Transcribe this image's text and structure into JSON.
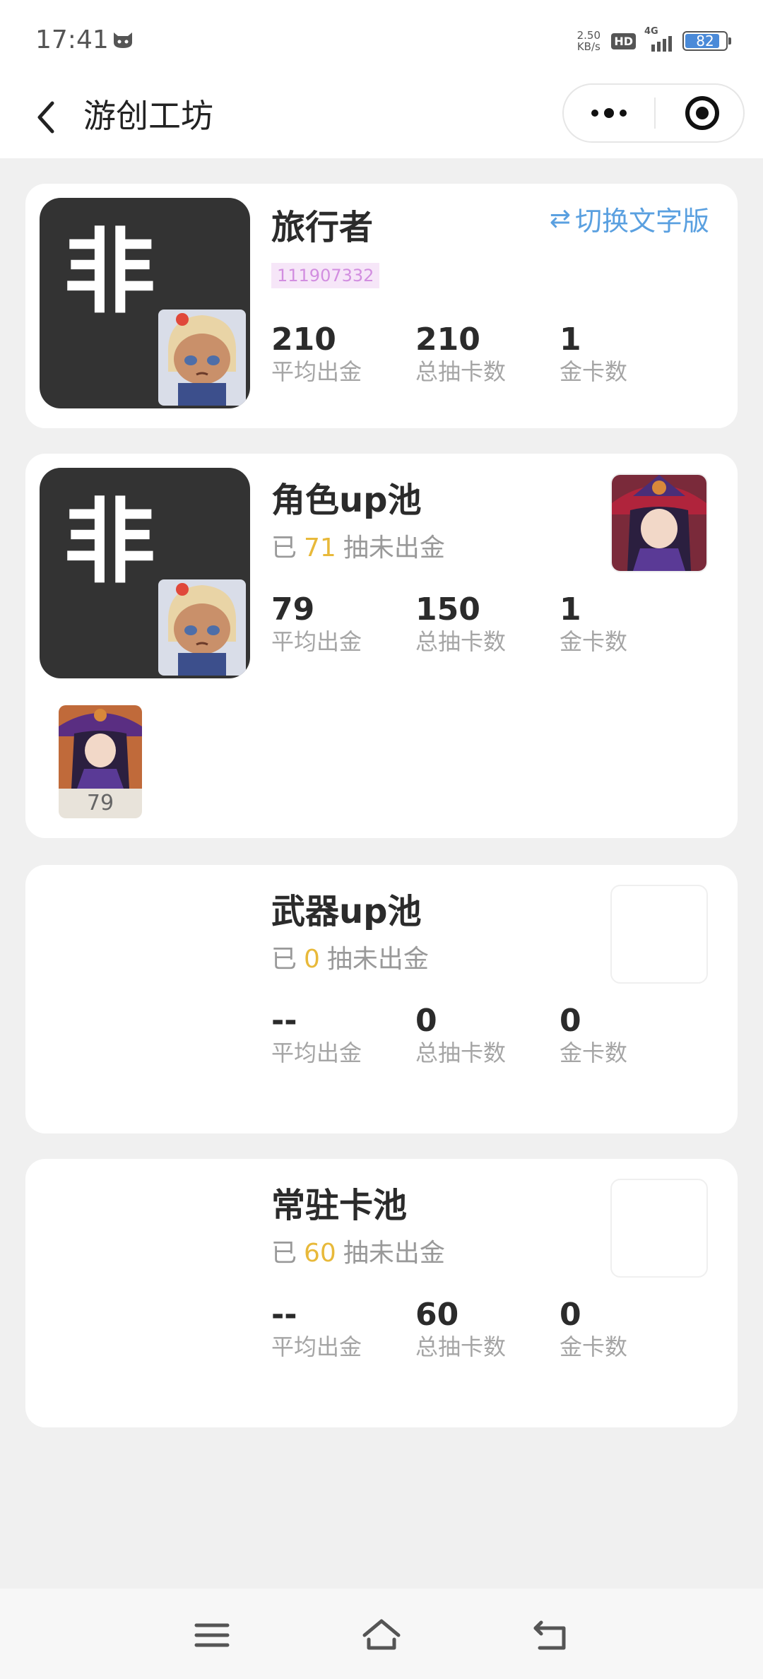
{
  "status_bar": {
    "time": "17:41",
    "net_speed_value": "2.50",
    "net_speed_unit": "KB/s",
    "hd": "HD",
    "network": "4G",
    "battery": "82"
  },
  "nav": {
    "title": "游创工坊"
  },
  "profile_card": {
    "avatar_char": "非",
    "name": "旅行者",
    "uid": "111907332",
    "switch_label": "切换文字版",
    "stats": [
      {
        "value": "210",
        "label": "平均出金"
      },
      {
        "value": "210",
        "label": "总抽卡数"
      },
      {
        "value": "1",
        "label": "金卡数"
      }
    ]
  },
  "pools": [
    {
      "title": "角色up池",
      "sub_prefix": "已",
      "sub_count": "71",
      "sub_suffix": "抽未出金",
      "avatar_char": "非",
      "stats": [
        {
          "value": "79",
          "label": "平均出金"
        },
        {
          "value": "150",
          "label": "总抽卡数"
        },
        {
          "value": "1",
          "label": "金卡数"
        }
      ],
      "history_count": "79"
    },
    {
      "title": "武器up池",
      "sub_prefix": "已",
      "sub_count": "0",
      "sub_suffix": "抽未出金",
      "stats": [
        {
          "value": "--",
          "label": "平均出金"
        },
        {
          "value": "0",
          "label": "总抽卡数"
        },
        {
          "value": "0",
          "label": "金卡数"
        }
      ]
    },
    {
      "title": "常驻卡池",
      "sub_prefix": "已",
      "sub_count": "60",
      "sub_suffix": "抽未出金",
      "stats": [
        {
          "value": "--",
          "label": "平均出金"
        },
        {
          "value": "60",
          "label": "总抽卡数"
        },
        {
          "value": "0",
          "label": "金卡数"
        }
      ]
    }
  ],
  "colors": {
    "accent_blue": "#5aa0e0",
    "highlight_yellow": "#e8b93a",
    "uid_pink": "#d28ee0"
  },
  "icons": {
    "back": "chevron-left-icon",
    "more": "more-dots-icon",
    "close": "target-close-icon",
    "switch": "swap-arrows-icon",
    "nav_menu": "menu-icon",
    "nav_home": "home-icon",
    "nav_back": "back-return-icon"
  }
}
